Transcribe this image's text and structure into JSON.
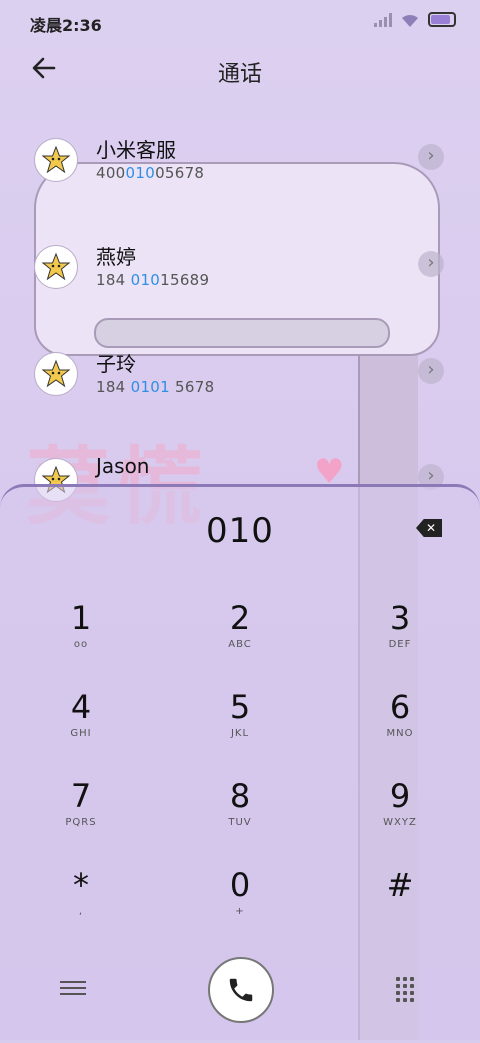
{
  "status_bar": {
    "time": "凌晨2:36",
    "battery_color": "#9a7fd6"
  },
  "header": {
    "back_icon": "back-arrow-icon",
    "title": "通话"
  },
  "results": [
    {
      "name": "小米客服",
      "number_pre": "400",
      "number_hl": "010",
      "number_post": "05678"
    },
    {
      "name": "燕婷",
      "number_pre": "184 ",
      "number_hl": "010",
      "number_post": "15689"
    },
    {
      "name": "子玲",
      "number_pre": "184 ",
      "number_hl": "0101",
      "number_post": " 5678"
    },
    {
      "name": "Jason",
      "number_pre": "",
      "number_hl": "",
      "number_post": ""
    }
  ],
  "dialpad": {
    "input_value": "010",
    "keys": [
      {
        "digit": "1",
        "letters": "oo"
      },
      {
        "digit": "2",
        "letters": "ABC"
      },
      {
        "digit": "3",
        "letters": "DEF"
      },
      {
        "digit": "4",
        "letters": "GHI"
      },
      {
        "digit": "5",
        "letters": "JKL"
      },
      {
        "digit": "6",
        "letters": "MNO"
      },
      {
        "digit": "7",
        "letters": "PQRS"
      },
      {
        "digit": "8",
        "letters": "TUV"
      },
      {
        "digit": "9",
        "letters": "WXYZ"
      },
      {
        "digit": "*",
        "letters": ","
      },
      {
        "digit": "0",
        "letters": "+"
      },
      {
        "digit": "#",
        "letters": ""
      }
    ]
  },
  "colors": {
    "highlight": "#2f8fe6",
    "panel_border": "#8b79b8"
  }
}
